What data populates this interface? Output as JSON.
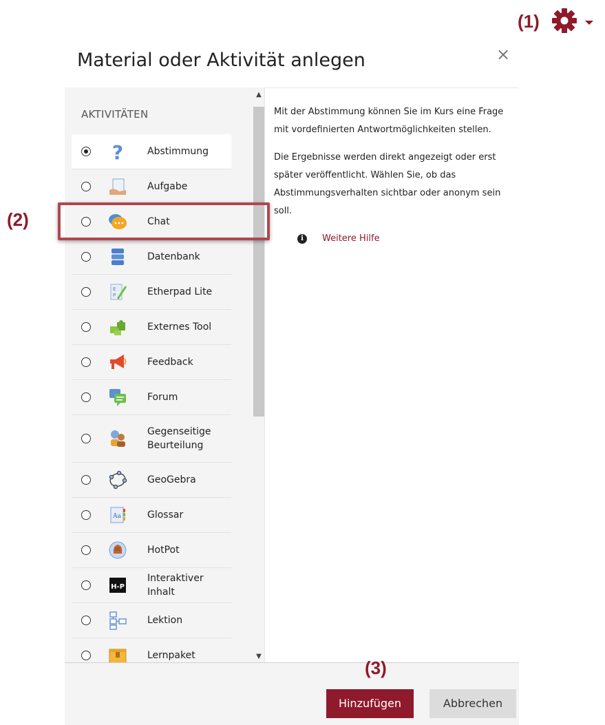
{
  "annotations": {
    "one": "(1)",
    "two": "(2)",
    "three": "(3)"
  },
  "dialog": {
    "title": "Material oder Aktivität anlegen",
    "close": "×"
  },
  "section": {
    "heading": "AKTIVITÄTEN"
  },
  "items": [
    {
      "label": "Abstimmung",
      "icon": "question-icon",
      "selected": true
    },
    {
      "label": "Aufgabe",
      "icon": "assignment-icon"
    },
    {
      "label": "Chat",
      "icon": "chat-icon"
    },
    {
      "label": "Datenbank",
      "icon": "database-icon"
    },
    {
      "label": "Etherpad Lite",
      "icon": "etherpad-icon"
    },
    {
      "label": "Externes Tool",
      "icon": "puzzle-icon"
    },
    {
      "label": "Feedback",
      "icon": "megaphone-icon"
    },
    {
      "label": "Forum",
      "icon": "forum-icon"
    },
    {
      "label": "Gegenseitige Beurteilung",
      "icon": "peer-review-icon"
    },
    {
      "label": "GeoGebra",
      "icon": "geogebra-icon"
    },
    {
      "label": "Glossar",
      "icon": "glossary-icon"
    },
    {
      "label": "HotPot",
      "icon": "hotpot-icon"
    },
    {
      "label": "Interaktiver Inhalt",
      "icon": "h5p-icon"
    },
    {
      "label": "Lektion",
      "icon": "lesson-icon"
    },
    {
      "label": "Lernpaket",
      "icon": "package-icon"
    }
  ],
  "description": {
    "para1": "Mit der Abstimmung können Sie im Kurs eine Frage mit vordefinierten Antwortmöglichkeiten stellen.",
    "para2": "Die Ergebnisse werden direkt angezeigt oder erst später veröffentlicht. Wählen Sie, ob das Abstimmungsverhalten sichtbar oder anonym sein soll.",
    "help": "Weitere Hilfe"
  },
  "buttons": {
    "add": "Hinzufügen",
    "cancel": "Abbrechen"
  },
  "colors": {
    "brand": "#8e1a2c",
    "highlight": "#b0474f"
  }
}
